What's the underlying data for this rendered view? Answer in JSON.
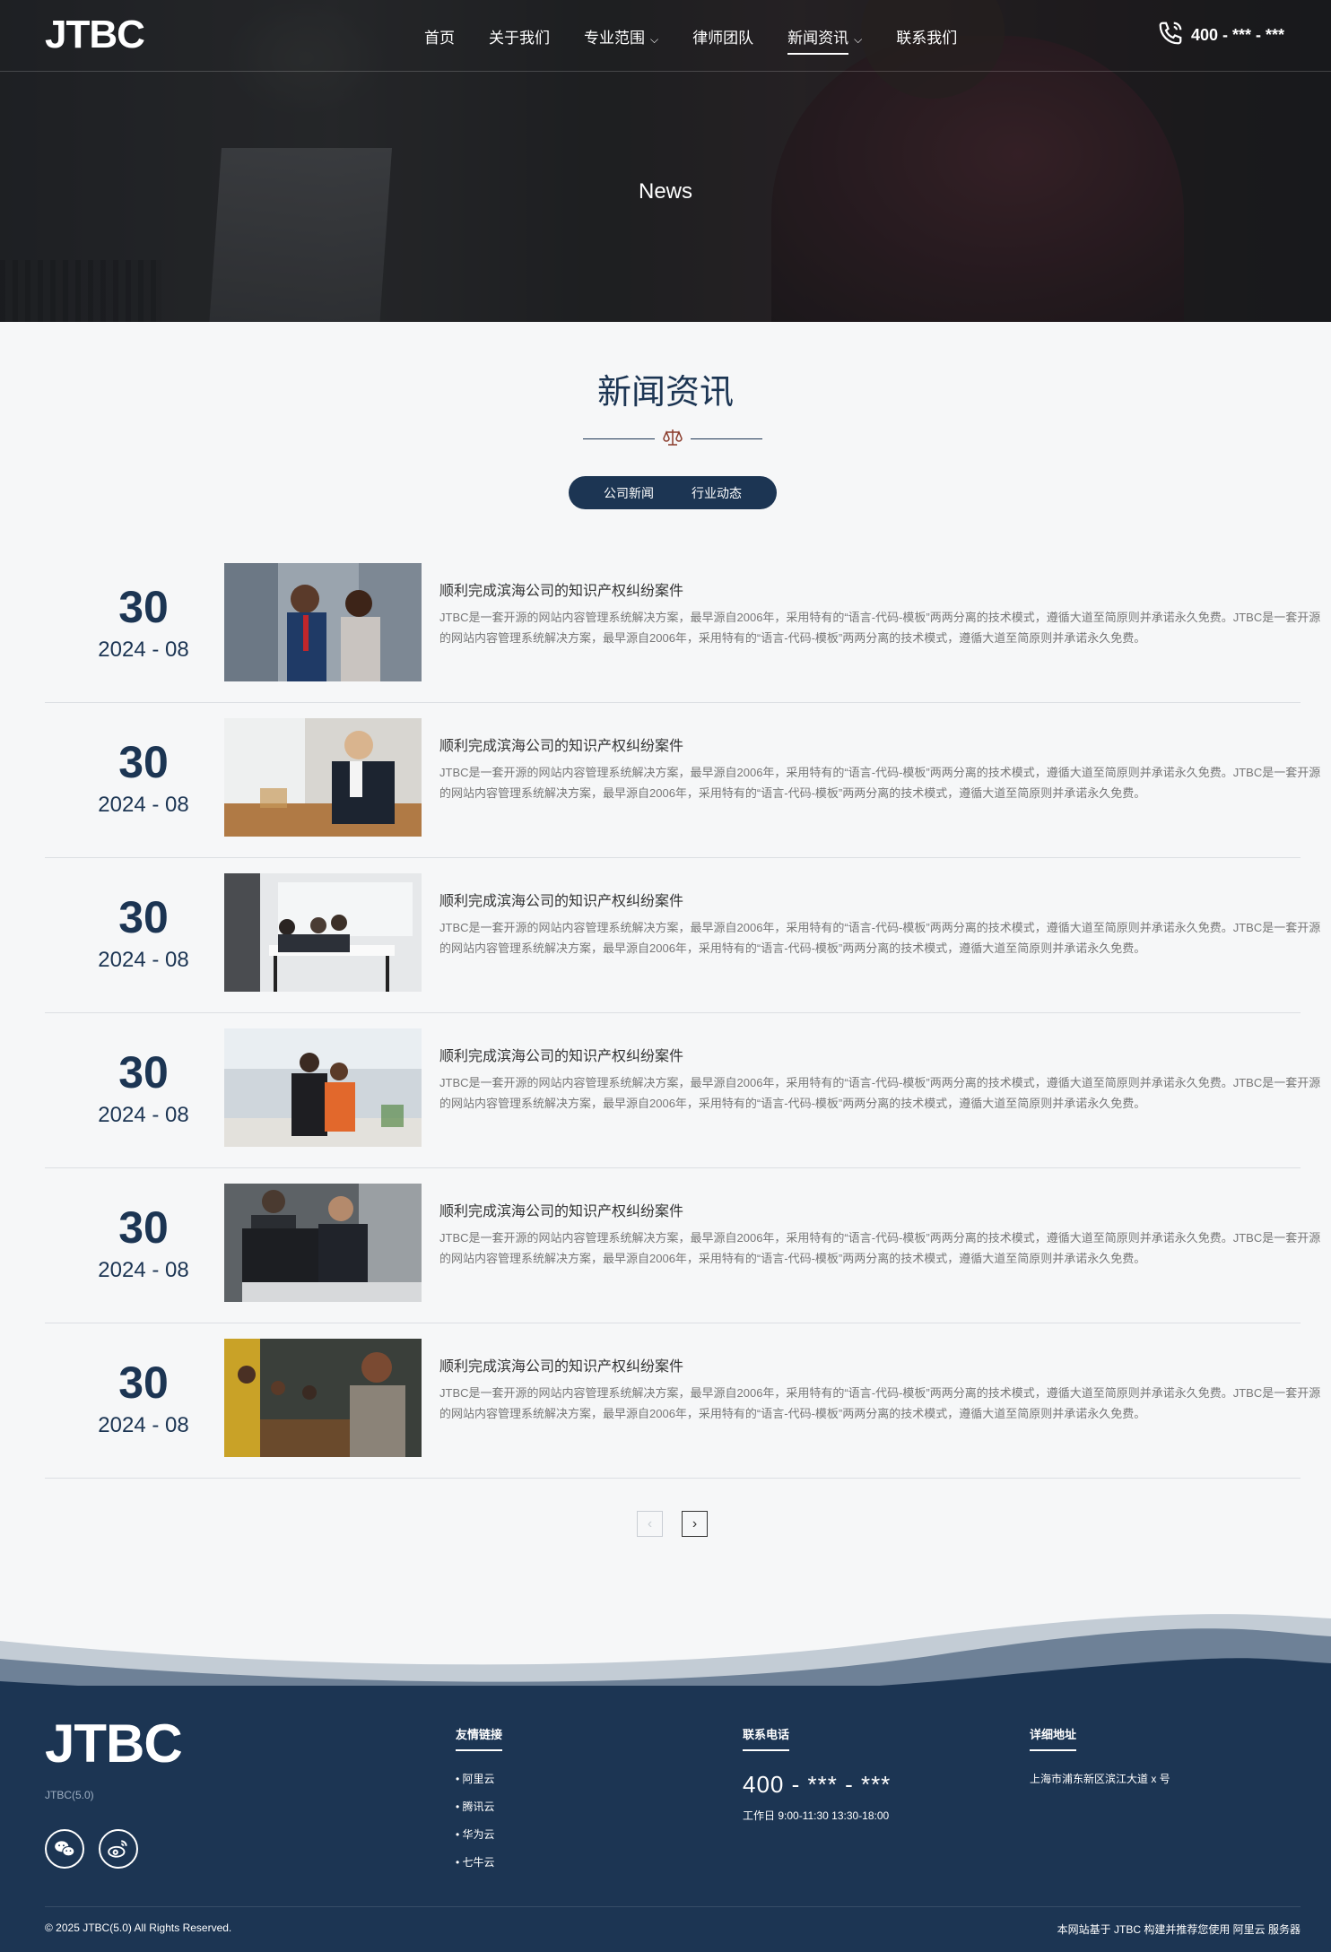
{
  "header": {
    "logo": "JTBC",
    "nav": [
      {
        "label": "首页",
        "has_dropdown": false
      },
      {
        "label": "关于我们",
        "has_dropdown": false
      },
      {
        "label": "专业范围",
        "has_dropdown": true
      },
      {
        "label": "律师团队",
        "has_dropdown": false
      },
      {
        "label": "新闻资讯",
        "has_dropdown": true,
        "active": true
      },
      {
        "label": "联系我们",
        "has_dropdown": false
      }
    ],
    "phone": "400 - *** - ***",
    "phone_icon": "phone-icon"
  },
  "hero": {
    "title": "News"
  },
  "section": {
    "title": "新闻资讯",
    "divider_icon": "scales-icon",
    "tabs": [
      "公司新闻",
      "行业动态"
    ]
  },
  "news": [
    {
      "day": "30",
      "year_month": "2024 - 08",
      "title": "顺利完成滨海公司的知识产权纠纷案件",
      "desc": "JTBC是一套开源的网站内容管理系统解决方案，最早源自2006年，采用特有的“语言-代码-模板”两两分离的技术模式，遵循大道至简原则并承诺永久免费。JTBC是一套开源的网站内容管理系统解决方案，最早源自2006年，采用特有的“语言-代码-模板”两两分离的技术模式，遵循大道至简原则并承诺永久免费。"
    },
    {
      "day": "30",
      "year_month": "2024 - 08",
      "title": "顺利完成滨海公司的知识产权纠纷案件",
      "desc": "JTBC是一套开源的网站内容管理系统解决方案，最早源自2006年，采用特有的“语言-代码-模板”两两分离的技术模式，遵循大道至简原则并承诺永久免费。JTBC是一套开源的网站内容管理系统解决方案，最早源自2006年，采用特有的“语言-代码-模板”两两分离的技术模式，遵循大道至简原则并承诺永久免费。"
    },
    {
      "day": "30",
      "year_month": "2024 - 08",
      "title": "顺利完成滨海公司的知识产权纠纷案件",
      "desc": "JTBC是一套开源的网站内容管理系统解决方案，最早源自2006年，采用特有的“语言-代码-模板”两两分离的技术模式，遵循大道至简原则并承诺永久免费。JTBC是一套开源的网站内容管理系统解决方案，最早源自2006年，采用特有的“语言-代码-模板”两两分离的技术模式，遵循大道至简原则并承诺永久免费。"
    },
    {
      "day": "30",
      "year_month": "2024 - 08",
      "title": "顺利完成滨海公司的知识产权纠纷案件",
      "desc": "JTBC是一套开源的网站内容管理系统解决方案，最早源自2006年，采用特有的“语言-代码-模板”两两分离的技术模式，遵循大道至简原则并承诺永久免费。JTBC是一套开源的网站内容管理系统解决方案，最早源自2006年，采用特有的“语言-代码-模板”两两分离的技术模式，遵循大道至简原则并承诺永久免费。"
    },
    {
      "day": "30",
      "year_month": "2024 - 08",
      "title": "顺利完成滨海公司的知识产权纠纷案件",
      "desc": "JTBC是一套开源的网站内容管理系统解决方案，最早源自2006年，采用特有的“语言-代码-模板”两两分离的技术模式，遵循大道至简原则并承诺永久免费。JTBC是一套开源的网站内容管理系统解决方案，最早源自2006年，采用特有的“语言-代码-模板”两两分离的技术模式，遵循大道至简原则并承诺永久免费。"
    },
    {
      "day": "30",
      "year_month": "2024 - 08",
      "title": "顺利完成滨海公司的知识产权纠纷案件",
      "desc": "JTBC是一套开源的网站内容管理系统解决方案，最早源自2006年，采用特有的“语言-代码-模板”两两分离的技术模式，遵循大道至简原则并承诺永久免费。JTBC是一套开源的网站内容管理系统解决方案，最早源自2006年，采用特有的“语言-代码-模板”两两分离的技术模式，遵循大道至简原则并承诺永久免费。"
    }
  ],
  "pagination": {
    "prev": "‹",
    "next": "›"
  },
  "footer": {
    "logo": "JTBC",
    "version": "JTBC(5.0)",
    "social": [
      "wechat-icon",
      "weibo-icon"
    ],
    "links_title": "友情链接",
    "links": [
      "阿里云",
      "腾讯云",
      "华为云",
      "七牛云"
    ],
    "phone_title": "联系电话",
    "phone": "400 - *** - ***",
    "hours": "工作日 9:00-11:30 13:30-18:00",
    "address_title": "详细地址",
    "address": "上海市浦东新区滨江大道 x 号",
    "copyright": "© 2025 JTBC(5.0) All Rights Reserved.",
    "powered": "本网站基于 JTBC 构建并推荐您使用 阿里云 服务器"
  },
  "colors": {
    "primary": "#1c3553",
    "text": "#333333",
    "muted": "#777777",
    "background": "#f6f7f8"
  }
}
